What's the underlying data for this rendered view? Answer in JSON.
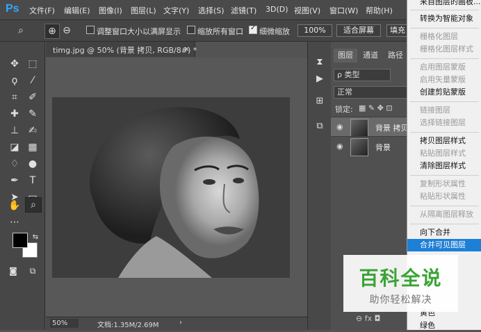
{
  "app": {
    "logo": "Ps"
  },
  "menu": [
    "文件(F)",
    "编辑(E)",
    "图像(I)",
    "图层(L)",
    "文字(Y)",
    "选择(S)",
    "滤镜(T)",
    "3D(D)",
    "视图(V)",
    "窗口(W)",
    "帮助(H)"
  ],
  "options": {
    "resize_windows": "调整窗口大小以满屏显示",
    "zoom_all": "缩放所有窗口",
    "scrubby_zoom": "细微缩放",
    "zoom_btn": "100%",
    "fit_btn": "适合屏幕",
    "fill_btn": "填充"
  },
  "document": {
    "tab_title": "timg.jpg @ 50% (背景 拷贝, RGB/8#) *",
    "close": "×",
    "zoom": "50%",
    "doc_info": "文档:1.35M/2.69M"
  },
  "layers_panel": {
    "tabs": [
      "图层",
      "通道",
      "路径"
    ],
    "filter_label": "ρ 类型",
    "blend_mode": "正常",
    "lock_label": "锁定:",
    "layers": [
      {
        "name": "背景 拷贝",
        "selected": true
      },
      {
        "name": "背景",
        "selected": false
      }
    ],
    "bottom_icons": "⊖  fx  ◘"
  },
  "context_menu": {
    "items": [
      {
        "label": "来自图层的画板...",
        "disabled": false
      },
      {
        "label": "转换为智能对象",
        "disabled": false
      },
      {
        "label": "栅格化图层",
        "disabled": true
      },
      {
        "label": "栅格化图层样式",
        "disabled": true
      },
      {
        "label": "启用图层蒙版",
        "disabled": true
      },
      {
        "label": "启用矢量蒙版",
        "disabled": true
      },
      {
        "label": "创建剪贴蒙版",
        "disabled": false
      },
      {
        "label": "链接图层",
        "disabled": true
      },
      {
        "label": "选择链接图层",
        "disabled": true
      },
      {
        "label": "拷贝图层样式",
        "disabled": false
      },
      {
        "label": "粘贴图层样式",
        "disabled": true
      },
      {
        "label": "清除图层样式",
        "disabled": false
      },
      {
        "label": "复制形状属性",
        "disabled": true
      },
      {
        "label": "粘贴形状属性",
        "disabled": true
      },
      {
        "label": "从隔离图层释放",
        "disabled": true
      },
      {
        "label": "向下合并",
        "disabled": false
      },
      {
        "label": "合并可见图层",
        "disabled": false,
        "highlighted": true
      },
      {
        "label": "黄色",
        "disabled": false
      },
      {
        "label": "绿色",
        "disabled": false
      }
    ]
  },
  "watermark": {
    "title": "百科全说",
    "subtitle": "助你轻松解决"
  },
  "colors": {
    "accent": "#31a8ff",
    "highlight": "#1e7fd6",
    "watermark_green": "#3aa435"
  }
}
